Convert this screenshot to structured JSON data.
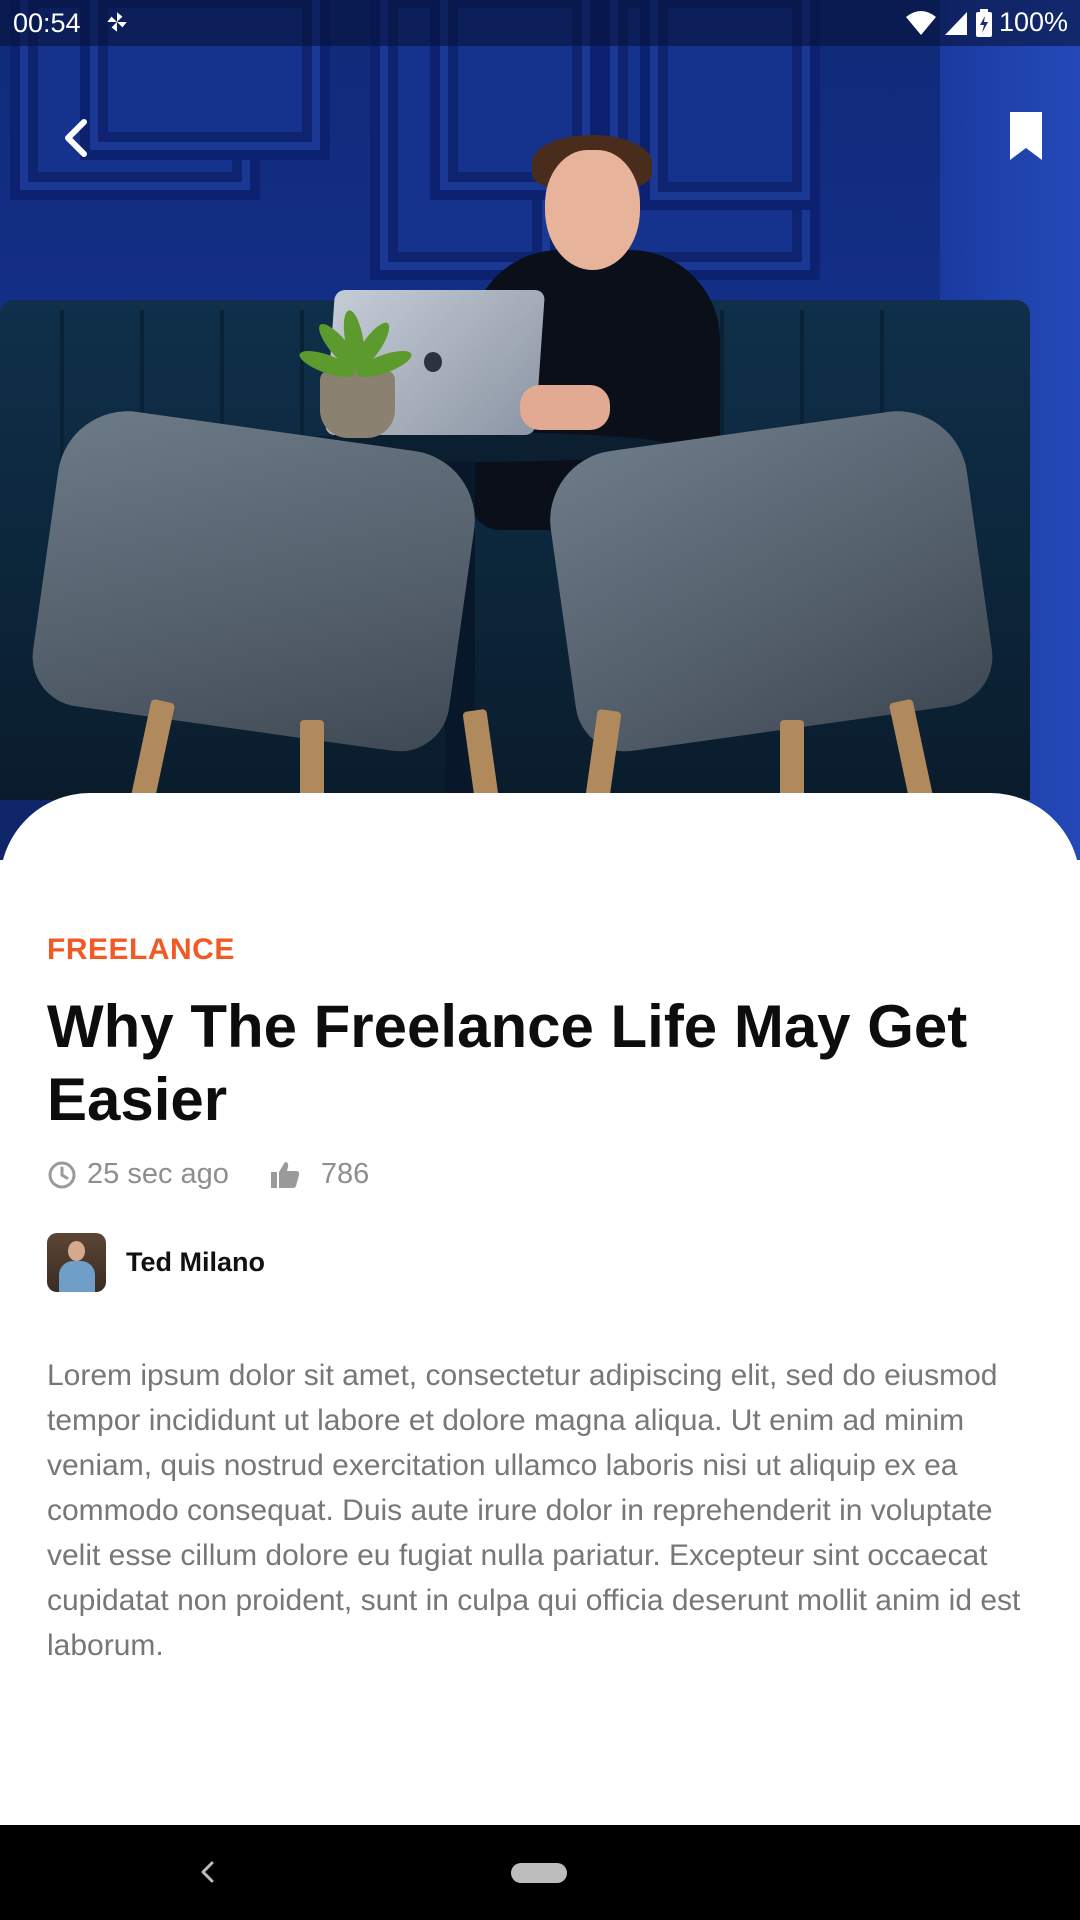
{
  "status_bar": {
    "time": "00:54",
    "battery": "100%",
    "icons": [
      "pinwheel-icon",
      "wifi-icon",
      "signal-icon",
      "battery-icon"
    ]
  },
  "top_actions": {
    "back_icon": "chevron-left-icon",
    "bookmark_icon": "bookmark-icon"
  },
  "article": {
    "category": "FREELANCE",
    "title": "Why The Freelance Life May Get Easier",
    "time_ago": "25 sec ago",
    "likes": "786",
    "author": {
      "name": "Ted Milano"
    },
    "body": "Lorem ipsum dolor sit amet, consectetur adipiscing elit, sed do eiusmod tempor incididunt ut labore et dolore magna aliqua. Ut enim ad minim veniam, quis nostrud exercitation ullamco laboris nisi ut aliquip ex ea commodo consequat. Duis aute irure dolor in reprehenderit in voluptate velit esse cillum dolore eu fugiat nulla pariatur. Excepteur sint occaecat cupidatat non proident, sunt in culpa qui officia deserunt mollit anim id est laborum."
  },
  "colors": {
    "accent": "#f15a24",
    "title": "#0d0d0d",
    "muted": "#8e8e8e",
    "body": "#777777"
  },
  "nav_bar": {
    "back_icon": "nav-back-icon",
    "home_icon": "home-pill-icon"
  }
}
